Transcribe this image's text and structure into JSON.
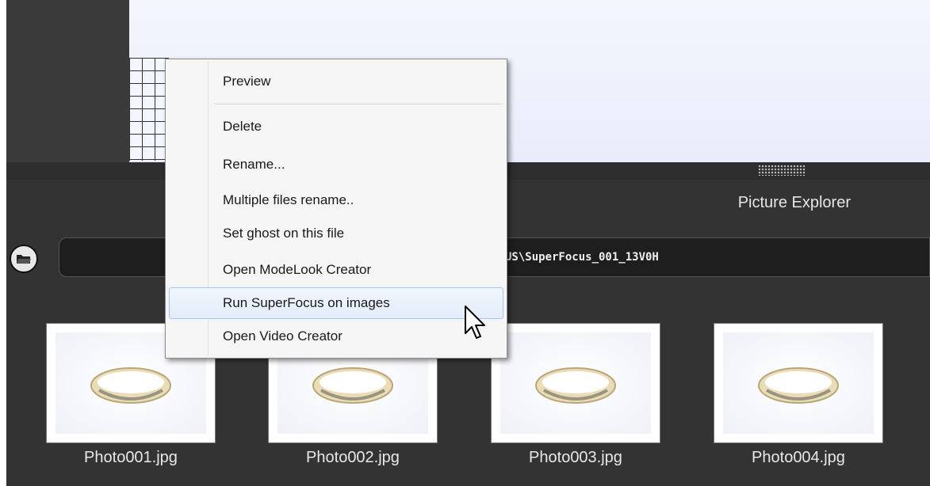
{
  "menu": {
    "items": [
      {
        "label": "Preview"
      },
      {
        "label": "Delete"
      },
      {
        "label": "Rename..."
      },
      {
        "label": "Multiple files rename.."
      },
      {
        "label": "Set ghost on this file"
      },
      {
        "label": "Open ModeLook Creator"
      },
      {
        "label": "Run SuperFocus on images"
      },
      {
        "label": "Open Video Creator"
      }
    ],
    "highlighted_item": "Run SuperFocus on images"
  },
  "explorer": {
    "title": "Picture Explorer",
    "path_visible": "US\\SuperFocus_001_13V0H",
    "thumbnails": [
      {
        "label": "Photo001.jpg"
      },
      {
        "label": "Photo002.jpg"
      },
      {
        "label": "Photo003.jpg"
      },
      {
        "label": "Photo004.jpg"
      }
    ]
  },
  "icons": {
    "folder_button": "folder-open-icon",
    "cursor": "mouse-pointer-icon",
    "grip": "resize-grip-icon"
  },
  "colors": {
    "panel_bg": "#333333",
    "preview_bg": "#eef0fb",
    "menu_highlight": "#dce8fb"
  }
}
